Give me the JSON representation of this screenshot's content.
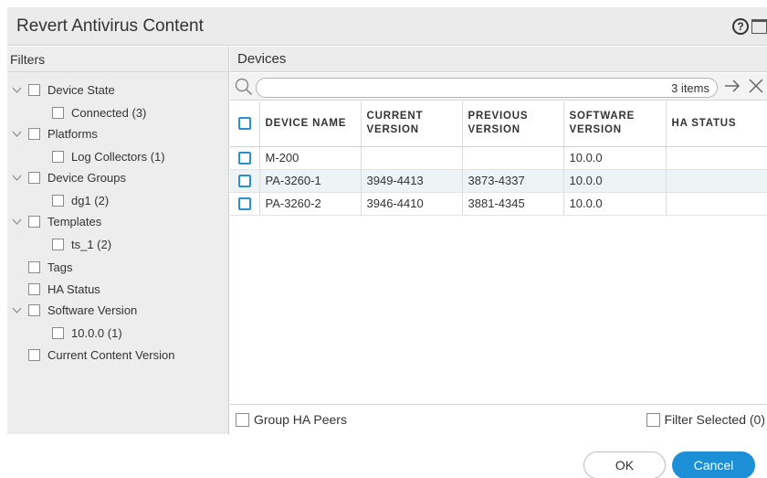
{
  "dialog": {
    "title": "Revert Antivirus Content"
  },
  "filters": {
    "header": "Filters",
    "items": [
      {
        "label": "Device State",
        "expandable": true
      },
      {
        "label": "Connected (3)",
        "expandable": false
      },
      {
        "label": "Platforms",
        "expandable": true
      },
      {
        "label": "Log Collectors (1)",
        "expandable": false
      },
      {
        "label": "Device Groups",
        "expandable": true
      },
      {
        "label": "dg1 (2)",
        "expandable": false
      },
      {
        "label": "Templates",
        "expandable": true
      },
      {
        "label": "ts_1 (2)",
        "expandable": false
      },
      {
        "label": "Tags",
        "expandable": false
      },
      {
        "label": "HA Status",
        "expandable": false
      },
      {
        "label": "Software Version",
        "expandable": true
      },
      {
        "label": "10.0.0 (1)",
        "expandable": false
      },
      {
        "label": "Current Content Version",
        "expandable": false
      }
    ]
  },
  "devices": {
    "header": "Devices",
    "search": {
      "value": "",
      "items_count": "3 items"
    },
    "columns": [
      "DEVICE NAME",
      "CURRENT VERSION",
      "PREVIOUS VERSION",
      "SOFTWARE VERSION",
      "HA STATUS"
    ],
    "rows": [
      {
        "device_name": "M-200",
        "current_version": "",
        "previous_version": "",
        "software_version": "10.0.0",
        "ha_status": ""
      },
      {
        "device_name": "PA-3260-1",
        "current_version": "3949-4413",
        "previous_version": "3873-4337",
        "software_version": "10.0.0",
        "ha_status": ""
      },
      {
        "device_name": "PA-3260-2",
        "current_version": "3946-4410",
        "previous_version": "3881-4345",
        "software_version": "10.0.0",
        "ha_status": ""
      }
    ],
    "footer": {
      "group_ha_peers": "Group HA Peers",
      "filter_selected": "Filter Selected (0)"
    }
  },
  "buttons": {
    "ok": "OK",
    "cancel": "Cancel"
  },
  "colors": {
    "accent": "#1d8fd6",
    "selected_row": "#eef4f6"
  }
}
